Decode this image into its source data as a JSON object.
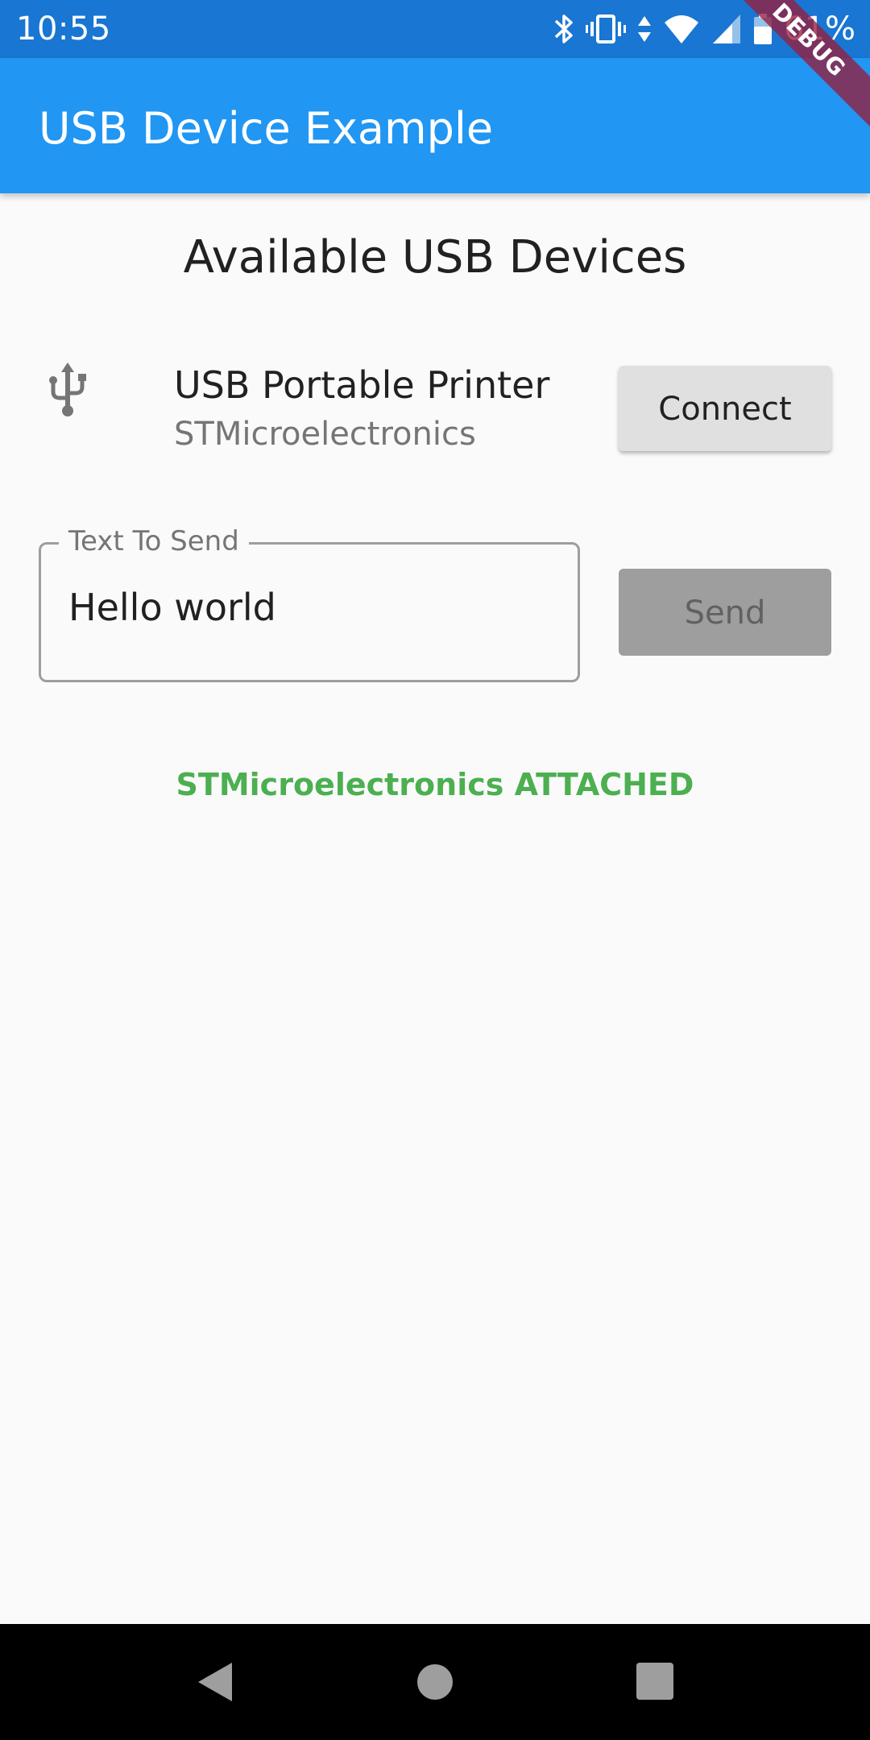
{
  "status_bar": {
    "time": "10:55",
    "battery": "61%",
    "icons": [
      "bluetooth-icon",
      "vibrate-icon",
      "data-arrows-icon",
      "wifi-icon",
      "signal-icon",
      "battery-icon"
    ]
  },
  "app_bar": {
    "title": "USB Device Example",
    "debug_banner": "DEBUG",
    "color": "#2196f3"
  },
  "content": {
    "section_title": "Available USB Devices",
    "devices": [
      {
        "icon": "usb-icon",
        "name": "USB Portable Printer",
        "manufacturer": "STMicroelectronics",
        "action_label": "Connect"
      }
    ],
    "text_field": {
      "label": "Text To Send",
      "value": "Hello world"
    },
    "send_label": "Send",
    "status_message": "STMicroelectronics ATTACHED",
    "status_color": "#4caf50"
  },
  "nav_bar": {
    "buttons": [
      "back-icon",
      "home-icon",
      "recents-icon"
    ]
  }
}
